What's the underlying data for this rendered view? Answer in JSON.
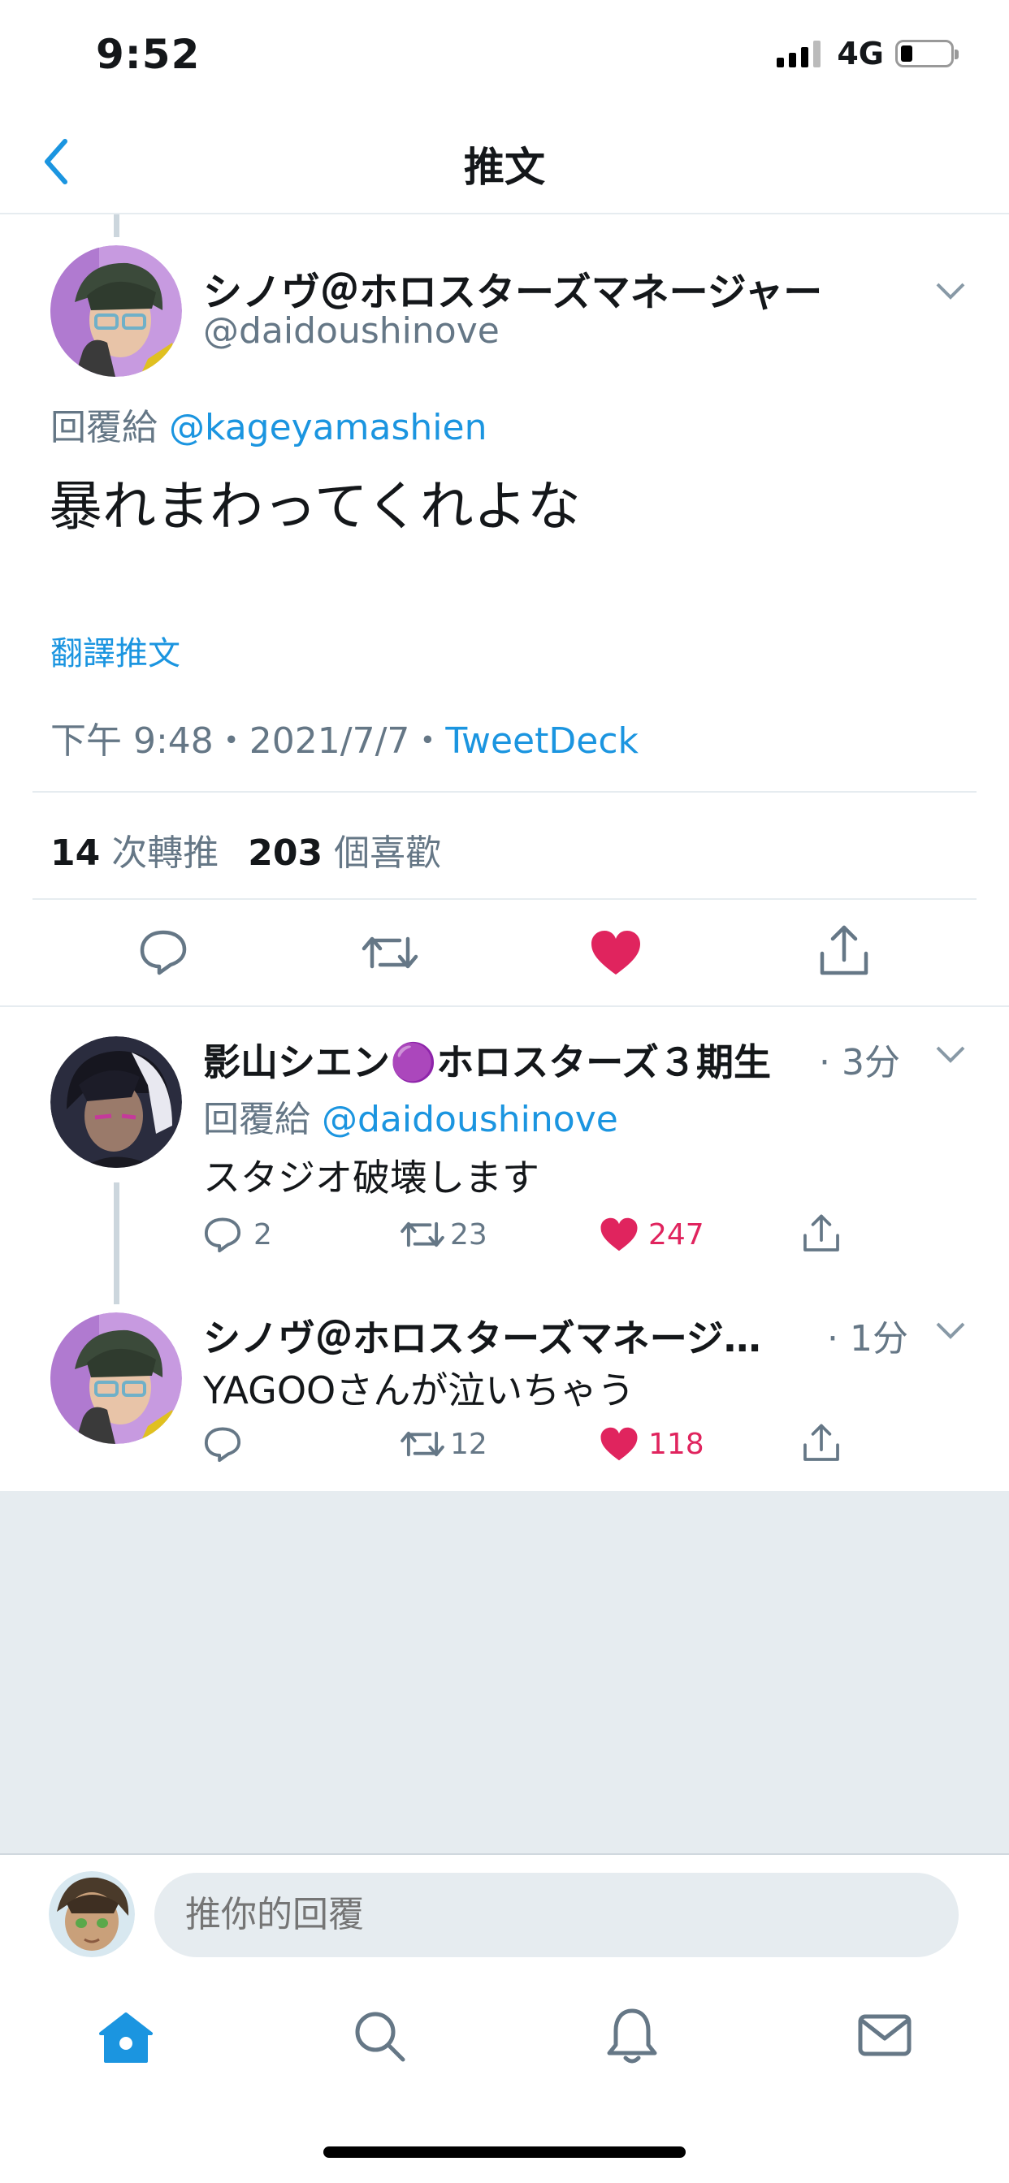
{
  "status_bar": {
    "time": "9:52",
    "network": "4G"
  },
  "nav": {
    "title": "推文"
  },
  "main_tweet": {
    "display_name": "シノヴ＠ホロスターズマネージャー",
    "handle": "@daidoushinove",
    "reply_prefix": "回覆給",
    "reply_to": "@kageyamashien",
    "text": "暴れまわってくれよな",
    "translate": "翻譯推文",
    "timestamp": "下午 9:48・2021/7/7・",
    "source": "TweetDeck",
    "retweet_count": "14",
    "retweet_label": "次轉推",
    "like_count": "203",
    "like_label": "個喜歡"
  },
  "replies": [
    {
      "display_name": "影山シエン🟣ホロスターズ３期生",
      "time": "· 3分",
      "reply_prefix": "回覆給",
      "reply_to": "@daidoushinove",
      "text": "スタジオ破壊します",
      "reply_count": "2",
      "retweet_count": "23",
      "like_count": "247"
    },
    {
      "display_name": "シノヴ＠ホロスターズマネージ…",
      "time": "· 1分",
      "text": "YAGOOさんが泣いちゃう",
      "reply_count": "",
      "retweet_count": "12",
      "like_count": "118"
    }
  ],
  "composer": {
    "placeholder": "推你的回覆"
  },
  "tab_bar": {
    "items": [
      "home",
      "search",
      "notifications",
      "messages"
    ],
    "active": "home"
  },
  "colors": {
    "accent": "#1b95e0",
    "like": "#e0245e",
    "muted": "#657786",
    "divider": "#e6ecf0"
  }
}
